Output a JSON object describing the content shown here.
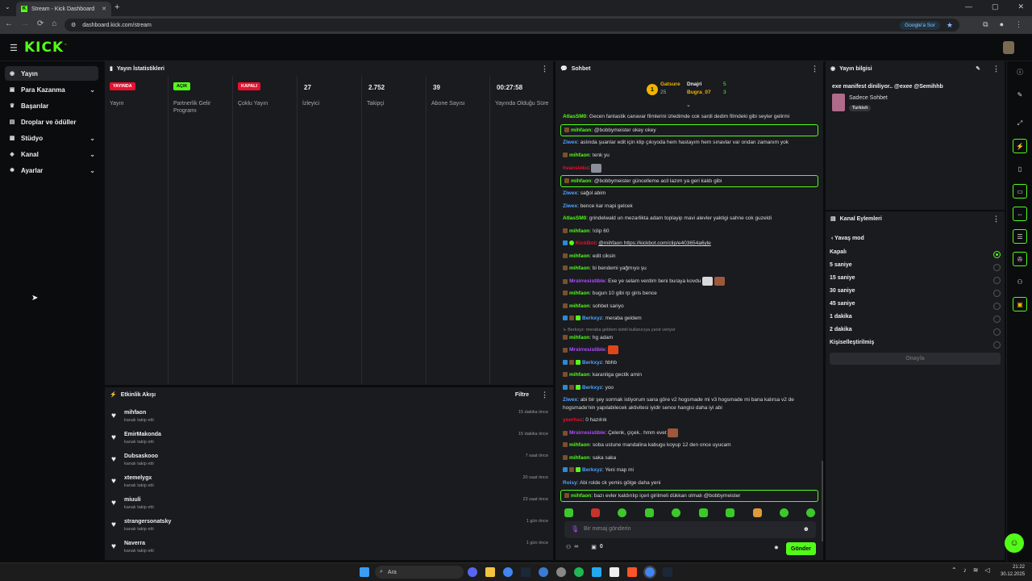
{
  "browser": {
    "tab_title": "Stream - Kick Dashboard",
    "url": "dashboard.kick.com/stream",
    "google_button": "Google'a Sor"
  },
  "sidebar": {
    "items": [
      {
        "label": "Yayın",
        "icon": "broadcast-icon"
      },
      {
        "label": "Para Kazanma",
        "icon": "money-icon"
      },
      {
        "label": "Başarılar",
        "icon": "trophy-icon"
      },
      {
        "label": "Droplar ve ödüller",
        "icon": "gift-icon"
      },
      {
        "label": "Stüdyo",
        "icon": "studio-icon"
      },
      {
        "label": "Kanal",
        "icon": "channel-icon"
      },
      {
        "label": "Ayarlar",
        "icon": "gear-icon"
      }
    ]
  },
  "stats": {
    "title": "Yayın İstatistikleri",
    "columns": [
      {
        "badge": "YAYINDA",
        "label": "Yayın",
        "badge_color": "#e8112d"
      },
      {
        "badge": "AÇIK",
        "label": "Partnerlik Gelir Programı",
        "badge_color": "#53fc18"
      },
      {
        "badge": "KAPALI",
        "label": "Çoklu Yayın",
        "badge_color": "#e8112d"
      },
      {
        "value": "27",
        "label": "İzleyici"
      },
      {
        "value": "2.752",
        "label": "Takipçi"
      },
      {
        "value": "39",
        "label": "Abone Sayısı"
      },
      {
        "value": "00:27:58",
        "label": "Yayında Olduğu Süre"
      }
    ]
  },
  "activity": {
    "title": "Etkinlik Akışı",
    "filter": "Filtre",
    "rows": [
      {
        "name": "mihfaon",
        "sub": "kanalı takip etti",
        "time": "15 dakika önce"
      },
      {
        "name": "EmirMakonda",
        "sub": "kanalı takip etti",
        "time": "15 dakika önce"
      },
      {
        "name": "Dubsaskooo",
        "sub": "kanalı takip etti",
        "time": "7 saat önce"
      },
      {
        "name": "xtemelygx",
        "sub": "kanalı takip etti",
        "time": "20 saat önce"
      },
      {
        "name": "miuuli",
        "sub": "kanalı takip etti",
        "time": "23 saat önce"
      },
      {
        "name": "strangersonatsky",
        "sub": "kanalı takip etti",
        "time": "1 gün önce"
      },
      {
        "name": "Naverra",
        "sub": "kanalı takip etti",
        "time": "1 gün önce"
      }
    ]
  },
  "chat": {
    "title": "Sohbet",
    "pinned": {
      "user1": "Gatsure",
      "count1": "25",
      "user2": "Dnajri",
      "count2": "5",
      "user3": "Bugra_07",
      "count3": "3"
    },
    "messages": [
      {
        "user": "AtlasSM0",
        "color": "#53fc18",
        "text": "Gecen fantastik canavar filmlerini izledimde cok sardi dedim filmdeki gibi seyler gelirmi",
        "hl": false
      },
      {
        "user": "mihfaon",
        "color": "#53fc18",
        "text": "@bobbymeister okey okey",
        "hl": true
      },
      {
        "user": "Ziwex",
        "color": "#4ea3ff",
        "text": "aslında şuanlar edit için klip çıkıyoda hem hastayım hem sınavlar var ondan zamanım yok",
        "hl": false
      },
      {
        "user": "mihfaon",
        "color": "#53fc18",
        "text": "tenk yu",
        "hl": false
      },
      {
        "user": "hvansleko",
        "color": "#e8112d",
        "text": "",
        "hl": false
      },
      {
        "user": "mihfaon",
        "color": "#53fc18",
        "text": "@bobbymeister güncelleme acil lazım ya geri kaldı gibi",
        "hl": true
      },
      {
        "user": "Ziwex",
        "color": "#4ea3ff",
        "text": "sağol abim",
        "hl": false
      },
      {
        "user": "Ziwex",
        "color": "#4ea3ff",
        "text": "bence kar mapi gelcek",
        "hl": false
      },
      {
        "user": "AtlasSM0",
        "color": "#53fc18",
        "text": "grindelwald un mezarlikta adam toplayip mavi alevler yaktigi sahne cok guzeldi",
        "hl": false
      },
      {
        "user": "mihfaon",
        "color": "#53fc18",
        "text": "!clip 60",
        "hl": false
      },
      {
        "user": "KickBot",
        "color": "#e8112d",
        "text": "@mihfaon https://kickbot.com/clip/e403654a6yle",
        "hl": false
      },
      {
        "user": "mihfaon",
        "color": "#53fc18",
        "text": "edit ciksin",
        "hl": false
      },
      {
        "user": "mihfaon",
        "color": "#53fc18",
        "text": "bi bendemi yağmıyo şu",
        "hl": false
      },
      {
        "user": "Mrsirresistible",
        "color": "#b44fff",
        "text": "Exe ye selam verdim beni buraya kovdu",
        "hl": false
      },
      {
        "user": "mihfaon",
        "color": "#53fc18",
        "text": "bugun 10 gibi rp giris bence",
        "hl": false
      },
      {
        "user": "mihfaon",
        "color": "#53fc18",
        "text": "sohbet sariyo",
        "hl": false
      },
      {
        "user": "Berkxyz",
        "color": "#4ea3ff",
        "text": "meraba geldem",
        "hl": false
      },
      {
        "user": "",
        "color": "#888888",
        "text": "Berkxyz: meraba geldem isimli kullanıcıya yanıt veriyor",
        "hl": false
      },
      {
        "user": "mihfaon",
        "color": "#53fc18",
        "text": "hg adam",
        "hl": false
      },
      {
        "user": "Mrsirresistible",
        "color": "#b44fff",
        "text": "",
        "hl": false
      },
      {
        "user": "Berkxyz",
        "color": "#4ea3ff",
        "text": "hbhb",
        "hl": false
      },
      {
        "user": "mihfaon",
        "color": "#53fc18",
        "text": "karanliga gectik amin",
        "hl": false
      },
      {
        "user": "Berkxyz",
        "color": "#4ea3ff",
        "text": "yoo",
        "hl": false
      },
      {
        "user": "Ziwex",
        "color": "#4ea3ff",
        "text": "abi bir şey sormak istiyorum sana göre v2 hogsmade mi v3 hogsmade mi bana kalırsa v2 de",
        "hl": false
      },
      {
        "user": "",
        "color": "#ddd",
        "text": "hogsmade'nin yapılabilecek aktivitesi iyidir sence hangisi daha iyi abi",
        "hl": false
      },
      {
        "user": "yeerhsc",
        "color": "#e8112d",
        "text": "0 hazılrık",
        "hl": false
      },
      {
        "user": "Mrsirresistible",
        "color": "#b44fff",
        "text": "Çelenk, çiçek.. hmm evet",
        "hl": false
      },
      {
        "user": "mihfaon",
        "color": "#53fc18",
        "text": "soba ustune mandalina kabugu koyup 12 den once uyucam",
        "hl": false
      },
      {
        "user": "mihfaon",
        "color": "#53fc18",
        "text": "saka saka",
        "hl": false
      },
      {
        "user": "Berkxyz",
        "color": "#4ea3ff",
        "text": "Yeni map mi",
        "hl": false
      },
      {
        "user": "Roisy",
        "color": "#4ea3ff",
        "text": "Abi rolde ck yemis gölge daha yeni",
        "hl": false
      },
      {
        "user": "mihfaon",
        "color": "#53fc18",
        "text": "bazı evler kaldırılıp içeri girilmeli dükkan olmalı @bobbymeister",
        "hl": true
      }
    ],
    "input_placeholder": "Bir mesaj gönderin",
    "send": "Gönder",
    "infinite": "∞",
    "zero": "0"
  },
  "stream_info": {
    "title": "Yayın bilgisi",
    "stream_title": "exe manifest diniliyor.. @exee @Semihhb",
    "category": "Sadece Sohbet",
    "tag": "Turkish"
  },
  "channel_actions": {
    "title": "Kanal Eylemleri",
    "back": "Yavaş mod",
    "options": [
      "Kapalı",
      "5 saniye",
      "15 saniye",
      "30 saniye",
      "45 saniye",
      "1 dakika",
      "2 dakika",
      "Kişiselleştirilmiş"
    ],
    "selected": 0,
    "confirm": "Onayla"
  },
  "taskbar": {
    "search": "Ara",
    "time": "21:22",
    "date": "30.12.2025"
  },
  "colors": {
    "accent": "#53fc18",
    "live": "#e8112d"
  }
}
